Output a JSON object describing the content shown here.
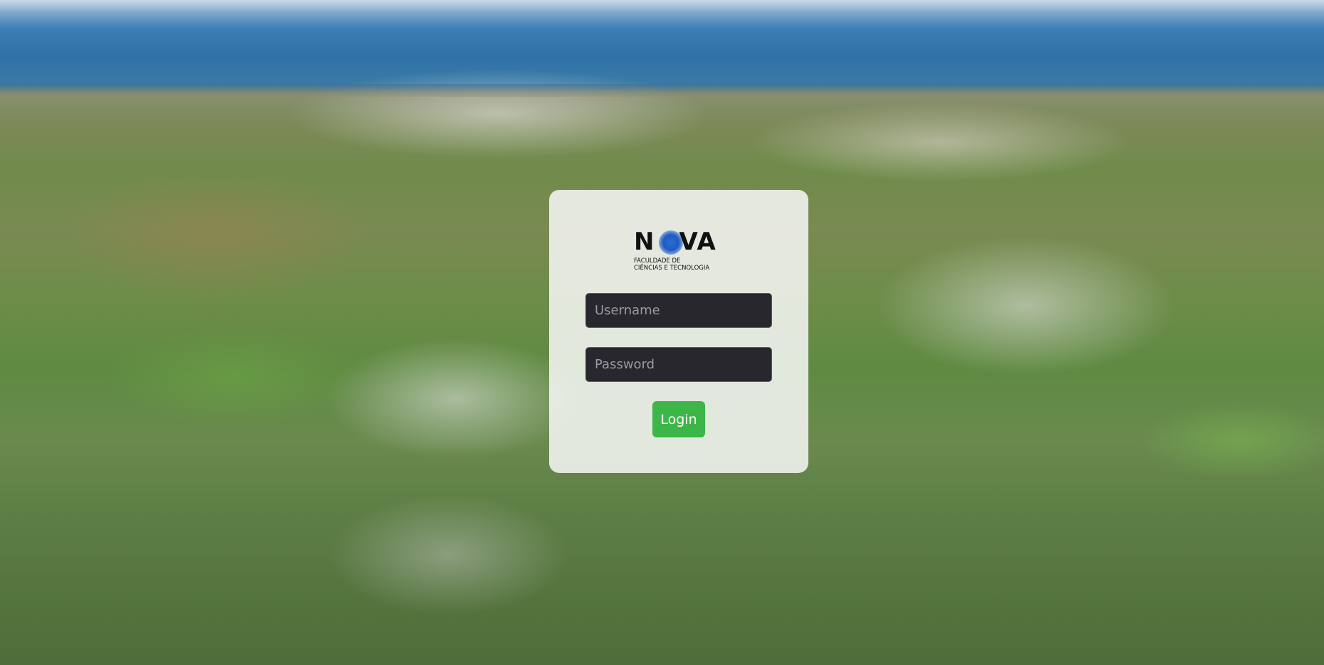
{
  "login": {
    "logo": {
      "word_n": "N",
      "word_rest": "VA",
      "subtitle_line1": "FACULDADE DE",
      "subtitle_line2": "CIÊNCIAS E TECNOLOGIA"
    },
    "username": {
      "placeholder": "Username",
      "value": ""
    },
    "password": {
      "placeholder": "Password",
      "value": ""
    },
    "login_button_label": "Login"
  },
  "colors": {
    "button": "#3db648",
    "field_bg": "#28272d",
    "card_bg": "rgba(250,250,250,0.84)",
    "logo_dot": "#1e5bc4"
  },
  "icons": [
    "nova-logo-icon"
  ]
}
